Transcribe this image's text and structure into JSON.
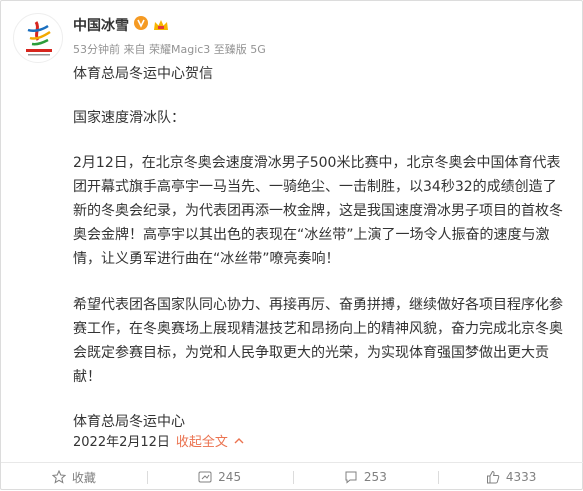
{
  "post": {
    "author": "中国冰雪",
    "meta": "53分钟前 来自 荣耀Magic3 至臻版 5G",
    "paragraphs": [
      "体育总局冬运中心贺信",
      "国家速度滑冰队：",
      "2月12日，在北京冬奥会速度滑冰男子500米比赛中，北京冬奥会中国体育代表团开幕式旗手高亭宇一马当先、一骑绝尘、一击制胜，以34秒32的成绩创造了新的冬奥会纪录，为代表团再添一枚金牌，这是我国速度滑冰男子项目的首枚冬奥会金牌！高亭宇以其出色的表现在“冰丝带”上演了一场令人振奋的速度与激情，让义勇军进行曲在“冰丝带”嘹亮奏响！",
      "希望代表团各国家队同心协力、再接再厉、奋勇拼搏，继续做好各项目程序化参赛工作，在冬奥赛场上展现精湛技艺和昂扬向上的精神风貌，奋力完成北京冬奥会既定参赛目标，为党和人民争取更大的光荣，为实现体育强国梦做出更大贡献！",
      "体育总局冬运中心"
    ],
    "date": "2022年2月12日",
    "collapse_label": "收起全文",
    "accent": "#eb7350",
    "verified_color": "#f59a23"
  },
  "actions": {
    "favorite_label": "收藏",
    "forward_count": "245",
    "comment_count": "253",
    "like_count": "4333"
  },
  "icons": [
    "logo",
    "verified-badge-icon",
    "vip-crown-icon",
    "chevron-up-icon",
    "star-icon",
    "forward-icon",
    "comment-icon",
    "like-icon"
  ]
}
